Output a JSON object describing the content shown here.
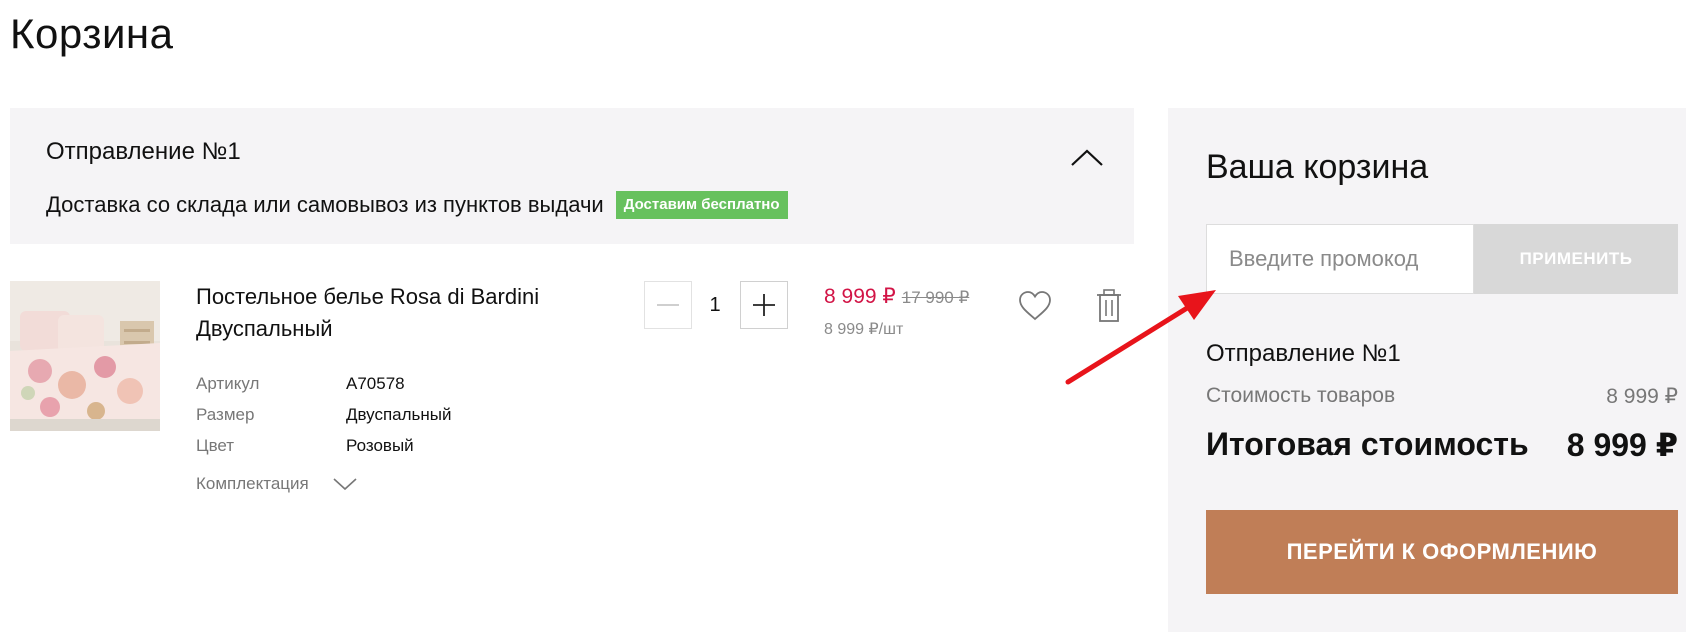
{
  "page": {
    "title": "Корзина"
  },
  "shipment": {
    "title": "Отправление №1",
    "delivery_text": "Доставка со склада или самовывоз из пунктов выдачи",
    "badge": "Доставим бесплатно",
    "badge_color": "#67c15e",
    "collapse_icon": "chevron-up-icon"
  },
  "product": {
    "name": "Постельное белье Rosa di Bardini Двуспальный",
    "attributes": [
      {
        "label": "Артикул",
        "value": "A70578"
      },
      {
        "label": "Размер",
        "value": "Двуспальный"
      },
      {
        "label": "Цвет",
        "value": "Розовый"
      }
    ],
    "kit_label": "Комплектация",
    "quantity": "1",
    "price": "8 999 ₽",
    "old_price": "17 990 ₽",
    "unit_price": "8 999 ₽/шт",
    "price_color": "#d21446",
    "icons": [
      "minus-icon",
      "plus-icon",
      "heart-icon",
      "trash-icon",
      "chevron-down-icon"
    ]
  },
  "summary": {
    "title": "Ваша корзина",
    "promo_placeholder": "Введите промокод",
    "promo_button": "ПРИМЕНИТЬ",
    "shipment_label": "Отправление №1",
    "goods_cost_label": "Стоимость товаров",
    "goods_cost_value": "8 999 ₽",
    "total_label": "Итоговая стоимость",
    "total_value": "8 999 ₽",
    "checkout_button": "ПЕРЕЙТИ К ОФОРМЛЕНИЮ",
    "checkout_color": "#c07e57"
  },
  "annotation": {
    "arrow_color": "#e8141b"
  }
}
